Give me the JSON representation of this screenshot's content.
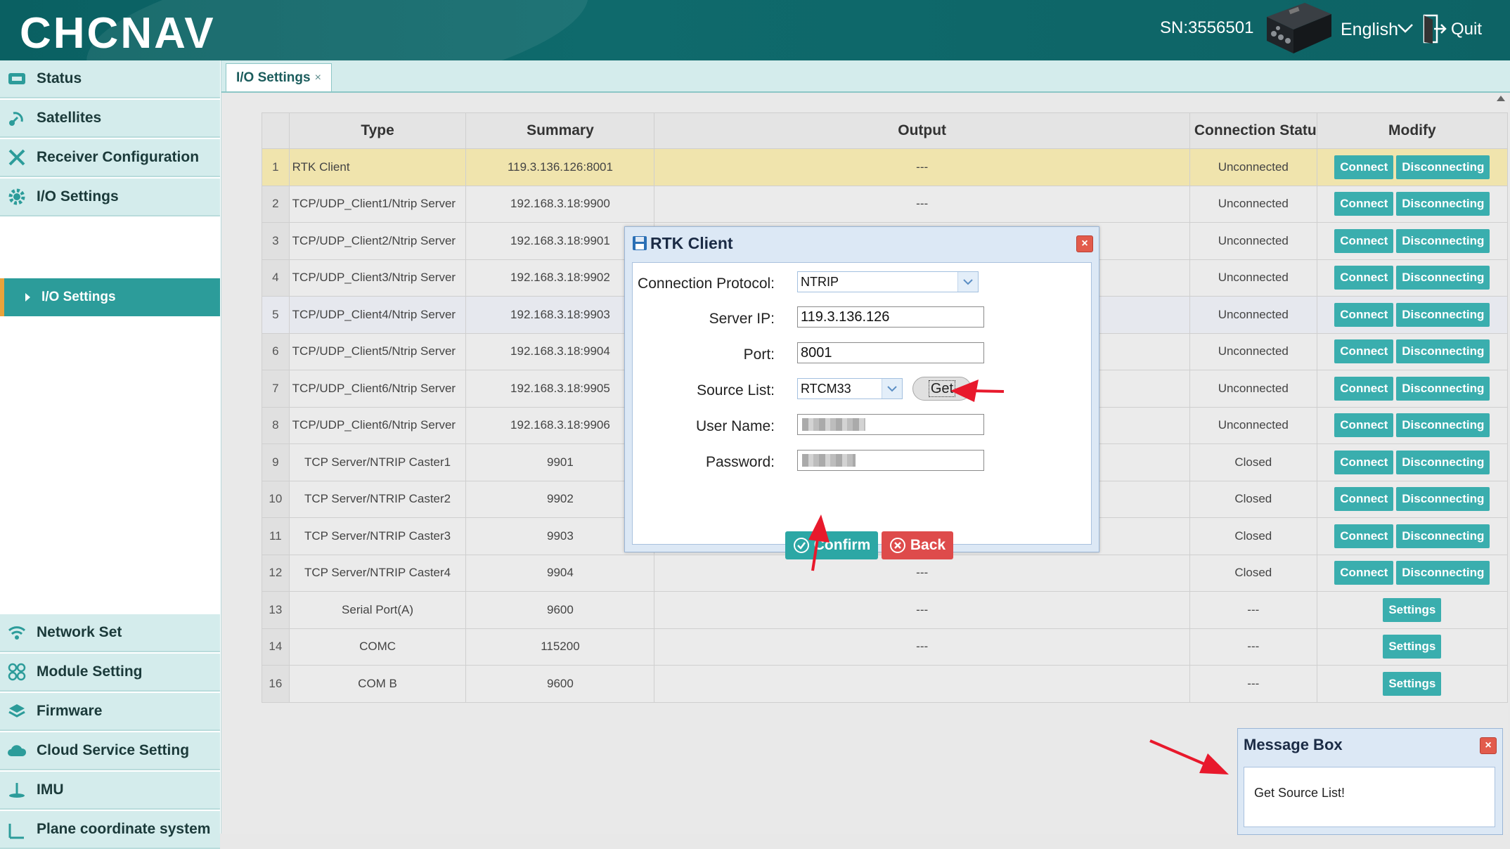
{
  "header": {
    "logo": "CHCNAV",
    "serial": "SN:3556501",
    "language": "English",
    "quit_label": "Quit"
  },
  "sidebar": {
    "items": [
      {
        "label": "Status",
        "icon": "status-icon"
      },
      {
        "label": "Satellites",
        "icon": "satellite-icon"
      },
      {
        "label": "Receiver Configuration",
        "icon": "tools-icon"
      },
      {
        "label": "I/O Settings",
        "icon": "gear-icon"
      },
      {
        "label": "Network Set",
        "icon": "wifi-icon"
      },
      {
        "label": "Module Setting",
        "icon": "modules-icon"
      },
      {
        "label": "Firmware",
        "icon": "layers-icon"
      },
      {
        "label": "Cloud Service Setting",
        "icon": "cloud-icon"
      },
      {
        "label": "IMU",
        "icon": "imu-icon"
      },
      {
        "label": "Plane coordinate system",
        "icon": "plane-icon"
      }
    ],
    "active_sub": "I/O Settings"
  },
  "tab": {
    "label": "I/O Settings",
    "close": "×"
  },
  "table": {
    "headers": [
      "Type",
      "Summary",
      "Output",
      "Connection Statu",
      "Modify"
    ],
    "rows": [
      {
        "n": "1",
        "type": "RTK Client",
        "summary": "119.3.136.126:8001",
        "output": "---",
        "status": "Unconnected",
        "mode": "connect"
      },
      {
        "n": "2",
        "type": "TCP/UDP_Client1/Ntrip Server",
        "summary": "192.168.3.18:9900",
        "output": "---",
        "status": "Unconnected",
        "mode": "connect"
      },
      {
        "n": "3",
        "type": "TCP/UDP_Client2/Ntrip Server",
        "summary": "192.168.3.18:9901",
        "output": "",
        "status": "Unconnected",
        "mode": "connect"
      },
      {
        "n": "4",
        "type": "TCP/UDP_Client3/Ntrip Server",
        "summary": "192.168.3.18:9902",
        "output": "",
        "status": "Unconnected",
        "mode": "connect"
      },
      {
        "n": "5",
        "type": "TCP/UDP_Client4/Ntrip Server",
        "summary": "192.168.3.18:9903",
        "output": "",
        "status": "Unconnected",
        "mode": "connect"
      },
      {
        "n": "6",
        "type": "TCP/UDP_Client5/Ntrip Server",
        "summary": "192.168.3.18:9904",
        "output": "",
        "status": "Unconnected",
        "mode": "connect"
      },
      {
        "n": "7",
        "type": "TCP/UDP_Client6/Ntrip Server",
        "summary": "192.168.3.18:9905",
        "output": "",
        "status": "Unconnected",
        "mode": "connect"
      },
      {
        "n": "8",
        "type": "TCP/UDP_Client6/Ntrip Server",
        "summary": "192.168.3.18:9906",
        "output": "",
        "status": "Unconnected",
        "mode": "connect"
      },
      {
        "n": "9",
        "type": "TCP Server/NTRIP Caster1",
        "summary": "9901",
        "output": "",
        "status": "Closed",
        "mode": "connect"
      },
      {
        "n": "10",
        "type": "TCP Server/NTRIP Caster2",
        "summary": "9902",
        "output": "",
        "status": "Closed",
        "mode": "connect"
      },
      {
        "n": "11",
        "type": "TCP Server/NTRIP Caster3",
        "summary": "9903",
        "output": "",
        "status": "Closed",
        "mode": "connect"
      },
      {
        "n": "12",
        "type": "TCP Server/NTRIP Caster4",
        "summary": "9904",
        "output": "---",
        "status": "Closed",
        "mode": "connect"
      },
      {
        "n": "13",
        "type": "Serial Port(A)",
        "summary": "9600",
        "output": "---",
        "status": "---",
        "mode": "settings"
      },
      {
        "n": "14",
        "type": "COMC",
        "summary": "115200",
        "output": "---",
        "status": "---",
        "mode": "settings"
      },
      {
        "n": "16",
        "type": "COM B",
        "summary": "9600",
        "output": "",
        "status": "---",
        "mode": "settings"
      }
    ],
    "connect_label": "Connect",
    "disconnect_label": "Disconnecting",
    "settings_label": "Settings"
  },
  "dialog": {
    "title": "RTK Client",
    "close": "×",
    "fields": {
      "protocol_label": "Connection Protocol:",
      "protocol_value": "NTRIP",
      "ip_label": "Server IP:",
      "ip_value": "119.3.136.126",
      "port_label": "Port:",
      "port_value": "8001",
      "source_label": "Source List:",
      "source_value": "RTCM33",
      "get_label": "Get",
      "user_label": "User Name:",
      "password_label": "Password:"
    },
    "confirm_label": "Confirm",
    "back_label": "Back"
  },
  "message_box": {
    "title": "Message Box",
    "close": "×",
    "text": "Get Source List!"
  },
  "colors": {
    "header": "#0d6365",
    "teal": "#3aaeae",
    "danger": "#de4b4b",
    "highlight_row": "#f0e4ad",
    "annotation_arrow": "#e8192c"
  }
}
